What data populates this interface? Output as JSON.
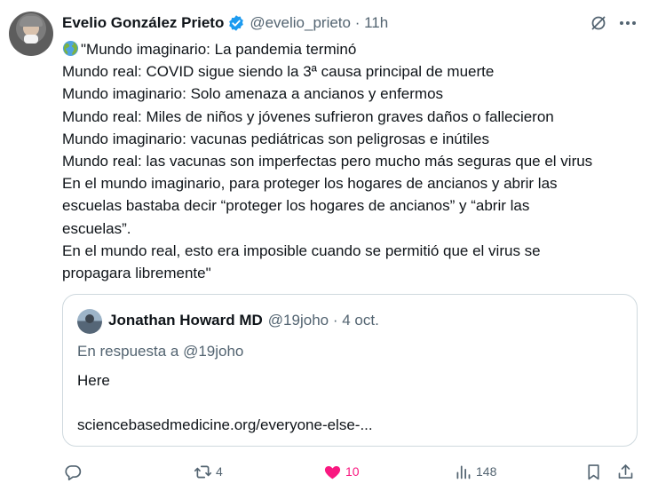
{
  "tweet": {
    "author_name": "Evelio González Prieto",
    "author_handle": "@evelio_prieto · 11h",
    "lines": [
      "\"Mundo imaginario: La pandemia terminó",
      "Mundo real: COVID sigue siendo la 3ª causa principal de muerte",
      "Mundo imaginario: Solo amenaza a ancianos y enfermos",
      "Mundo real: Miles de niños y jóvenes sufrieron graves daños o fallecieron",
      "Mundo imaginario: vacunas pediátricas son peligrosas e inútiles",
      "Mundo real: las vacunas son imperfectas pero mucho más seguras que el virus",
      "En el mundo imaginario, para proteger los hogares de ancianos y abrir las",
      "escuelas bastaba decir “proteger los hogares de ancianos” y “abrir las",
      "escuelas”.",
      "En el mundo real, esto era imposible cuando se permitió que el virus se",
      "propagara libremente\""
    ],
    "lead_icon": "globe-americas-emoji",
    "verified_color": "#1d9bf0"
  },
  "quoted": {
    "author_name": "Jonathan Howard MD",
    "author_handle": "@19joho · 4 oct.",
    "reply_to": "En respuesta a @19joho",
    "text": "Here\n\nsciencebasedmedicine.org/everyone-else-..."
  },
  "actions": {
    "reply_count": "",
    "retweet_count": "4",
    "like_count": "10",
    "views_count": "148",
    "like_color": "#f91880"
  }
}
